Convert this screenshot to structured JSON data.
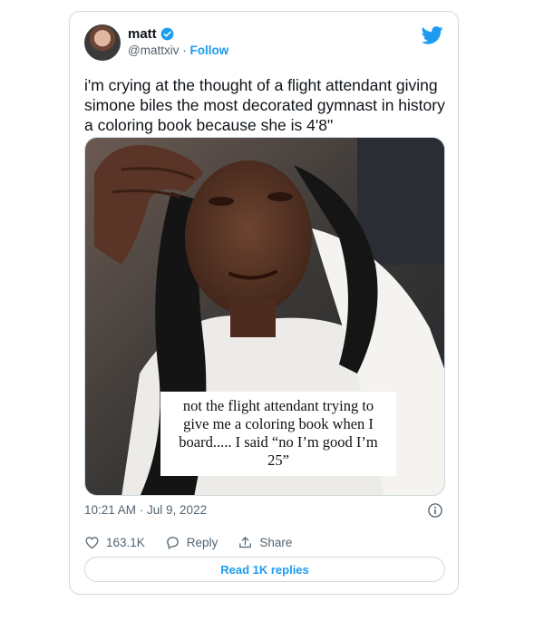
{
  "tweet": {
    "author": {
      "name": "matt",
      "handle": "@mattxiv",
      "separator": "·",
      "follow_label": "Follow"
    },
    "text_lines": [
      "i'm crying at the thought of a flight attendant giving",
      "simone biles the most decorated gymnast in history",
      "a coloring book because she is 4'8\""
    ],
    "media_caption_lines": [
      "not the flight attendant trying to",
      "give me a coloring book when I",
      "board..... I said “no I’m good I’m",
      "25”"
    ],
    "timestamp": "10:21 AM · Jul 9, 2022",
    "likes": "163.1K",
    "reply_label": "Reply",
    "share_label": "Share",
    "read_replies_label": "Read 1K replies"
  },
  "colors": {
    "accent": "#1d9bf0",
    "text": "#0f1419",
    "muted": "#536471",
    "border": "#cfd9de"
  },
  "icons": [
    "verified-badge-icon",
    "twitter-bird-icon",
    "info-icon",
    "heart-icon",
    "reply-icon",
    "share-icon"
  ]
}
